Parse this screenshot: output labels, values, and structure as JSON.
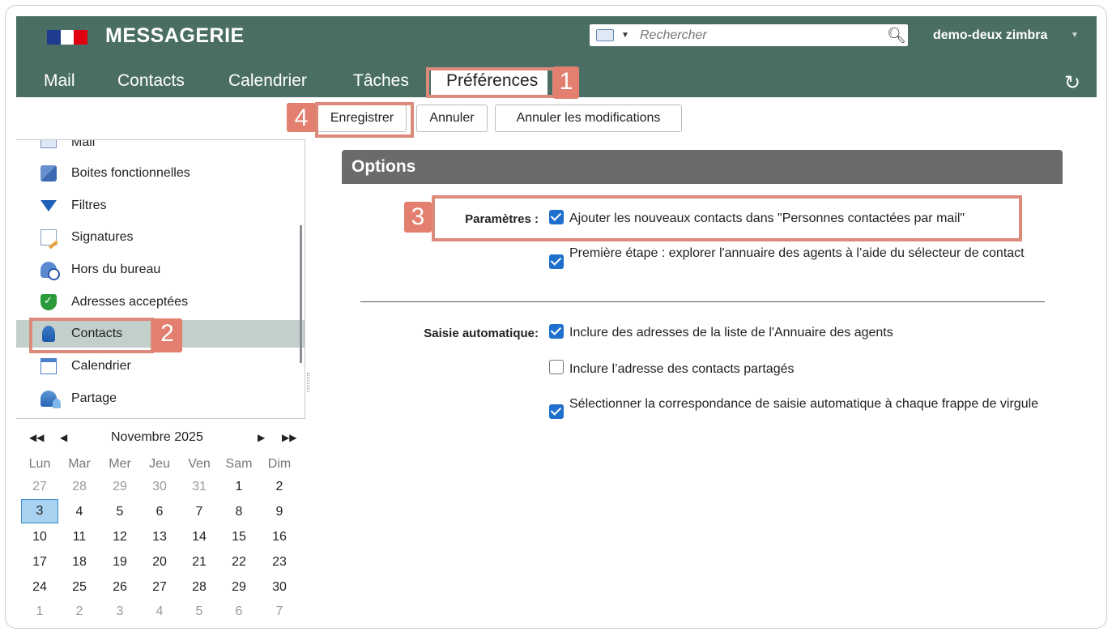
{
  "header": {
    "app_title": "MESSAGERIE",
    "search_placeholder": "Rechercher",
    "user": "demo-deux zimbra",
    "tabs": [
      "Mail",
      "Contacts",
      "Calendrier",
      "Tâches",
      "Préférences"
    ]
  },
  "toolbar": {
    "save": "Enregistrer",
    "cancel": "Annuler",
    "undo": "Annuler les modifications"
  },
  "nav": {
    "items": [
      "Mail",
      "Boites fonctionnelles",
      "Filtres",
      "Signatures",
      "Hors du bureau",
      "Adresses acceptées",
      "Contacts",
      "Calendrier",
      "Partage"
    ],
    "selected": "Contacts"
  },
  "calendar": {
    "month": "Novembre 2025",
    "days_of_week": [
      "Lun",
      "Mar",
      "Mer",
      "Jeu",
      "Ven",
      "Sam",
      "Dim"
    ],
    "weeks": [
      [
        "27",
        "28",
        "29",
        "30",
        "31",
        "1",
        "2"
      ],
      [
        "3",
        "4",
        "5",
        "6",
        "7",
        "8",
        "9"
      ],
      [
        "10",
        "11",
        "12",
        "13",
        "14",
        "15",
        "16"
      ],
      [
        "17",
        "18",
        "19",
        "20",
        "21",
        "22",
        "23"
      ],
      [
        "24",
        "25",
        "26",
        "27",
        "28",
        "29",
        "30"
      ],
      [
        "1",
        "2",
        "3",
        "4",
        "5",
        "6",
        "7"
      ]
    ],
    "today": "3"
  },
  "options": {
    "title": "Options",
    "params_label": "Paramètres :",
    "params_opt1": "Ajouter les nouveaux contacts dans \"Personnes contactées par mail\"",
    "params_opt2": "Première étape : explorer l'annuaire des agents à l’aide du sélecteur de contact",
    "auto_label": "Saisie automatique:",
    "auto_opt1": "Inclure des adresses de la liste de l'Annuaire des agents",
    "auto_opt2": "Inclure l’adresse des contacts partagés",
    "auto_opt3": "Sélectionner la correspondance de saisie automatique à chaque frappe de virgule"
  },
  "annotations": {
    "b1": "1",
    "b2": "2",
    "b3": "3",
    "b4": "4"
  },
  "colors": {
    "header": "#4a6e64",
    "options_bar": "#6b6b6b",
    "annotation": "#e27f6e",
    "checkbox": "#1f6fcc"
  }
}
